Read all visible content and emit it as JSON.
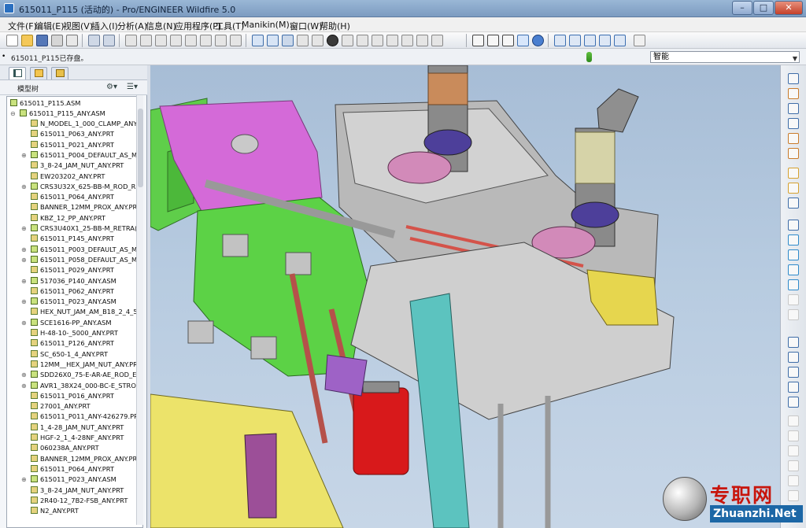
{
  "window": {
    "title": "615011_P115 (活动的) - Pro/ENGINEER Wildfire 5.0",
    "controls": {
      "minimize": "–",
      "maximize": "□",
      "close": "✕"
    }
  },
  "menu": {
    "items": [
      "文件(F)",
      "编辑(E)",
      "视图(V)",
      "插入(I)",
      "分析(A)",
      "信息(N)",
      "应用程序(P)",
      "工具(T)",
      "Manikin(M)...",
      "窗口(W)",
      "帮助(H)"
    ]
  },
  "toolbar": {
    "icons": [
      "new-icon",
      "open-icon",
      "save-icon",
      "print-icon",
      "send-icon",
      "undo-icon",
      "redo-icon",
      "cut-icon",
      "copy-icon",
      "paste-icon",
      "paste-special-icon",
      "find-icon",
      "select-icon",
      "rename-icon",
      "regenerate-icon",
      "datum-display-icon",
      "orient-icon",
      "appearance-icon",
      "pan-icon",
      "zoom-in-icon",
      "zoom-out-icon",
      "refit-icon",
      "reorient-icon",
      "saved-views-icon",
      "layers-icon",
      "wireframe-icon",
      "hidden-line-icon",
      "no-hidden-icon",
      "shading-icon",
      "enhanced-realism-icon",
      "plane-display-icon",
      "axis-display-icon",
      "point-display-icon",
      "csys-display-icon",
      "spin-center-icon",
      "context-help-icon"
    ]
  },
  "message": {
    "bullet": "•",
    "text": "615011_P115已存盘。"
  },
  "filter": {
    "value": "智能"
  },
  "panel": {
    "tabs": [
      "model-tree-tab",
      "folder-tab",
      "favorites-tab"
    ],
    "header_label": "模型树",
    "settings_icon": "tree-settings-icon",
    "show_icon": "tree-show-icon"
  },
  "tree": {
    "root": "615011_P115.ASM",
    "sub_root": "615011_P115_ANY.ASM",
    "items": [
      {
        "label": "N_MODEL_1_000_CLAMP_ANY",
        "type": "prt",
        "exp": ""
      },
      {
        "label": "615011_P063_ANY.PRT",
        "type": "prt",
        "exp": ""
      },
      {
        "label": "615011_P021_ANY.PRT",
        "type": "prt",
        "exp": ""
      },
      {
        "label": "615011_P004_DEFAULT_AS_M/",
        "type": "asm",
        "exp": "⊕"
      },
      {
        "label": "3_8-24_JAM_NUT_ANY.PRT",
        "type": "prt",
        "exp": ""
      },
      {
        "label": "EW203202_ANY.PRT",
        "type": "prt",
        "exp": ""
      },
      {
        "label": "CRS3U32X_625-BB-M_ROD_R",
        "type": "asm",
        "exp": "⊕"
      },
      {
        "label": "615011_P064_ANY.PRT",
        "type": "prt",
        "exp": ""
      },
      {
        "label": "BANNER_12MM_PROX_ANY.PR",
        "type": "prt",
        "exp": ""
      },
      {
        "label": "KBZ_12_PP_ANY.PRT",
        "type": "prt",
        "exp": ""
      },
      {
        "label": "CRS3U40X1_25-BB-M_RETRA(",
        "type": "asm",
        "exp": "⊕"
      },
      {
        "label": "615011_P145_ANY.PRT",
        "type": "prt",
        "exp": ""
      },
      {
        "label": "615011_P003_DEFAULT_AS_M/",
        "type": "asm",
        "exp": "⊕"
      },
      {
        "label": "615011_P058_DEFAULT_AS_M/",
        "type": "asm",
        "exp": "⊕"
      },
      {
        "label": "615011_P029_ANY.PRT",
        "type": "prt",
        "exp": ""
      },
      {
        "label": "517036_P140_ANY.ASM",
        "type": "asm",
        "exp": "⊕"
      },
      {
        "label": "615011_P062_ANY.PRT",
        "type": "prt",
        "exp": ""
      },
      {
        "label": "615011_P023_ANY.ASM",
        "type": "asm",
        "exp": "⊕"
      },
      {
        "label": "HEX_NUT_JAM_AM_B18_2_4_5",
        "type": "prt",
        "exp": ""
      },
      {
        "label": "SCE1616-PP_ANY.ASM",
        "type": "asm",
        "exp": "⊕"
      },
      {
        "label": "H-48-10-_5000_ANY.PRT",
        "type": "prt",
        "exp": ""
      },
      {
        "label": "615011_P126_ANY.PRT",
        "type": "prt",
        "exp": ""
      },
      {
        "label": "SC_650-1_4_ANY.PRT",
        "type": "prt",
        "exp": ""
      },
      {
        "label": "12MM__HEX_JAM_NUT_ANY.PR",
        "type": "prt",
        "exp": ""
      },
      {
        "label": "SDD26X0_75-E-AR-AE_ROD_E",
        "type": "asm",
        "exp": "⊕"
      },
      {
        "label": "AVR1_38X24_000-BC-E_STROI",
        "type": "asm",
        "exp": "⊕"
      },
      {
        "label": "615011_P016_ANY.PRT",
        "type": "prt",
        "exp": ""
      },
      {
        "label": "27001_ANY.PRT",
        "type": "prt",
        "exp": ""
      },
      {
        "label": "615011_P011_ANY-426279.PRT",
        "type": "prt",
        "exp": ""
      },
      {
        "label": "1_4-28_JAM_NUT_ANY.PRT",
        "type": "prt",
        "exp": ""
      },
      {
        "label": "HGF-2_1_4-28NF_ANY.PRT",
        "type": "prt",
        "exp": ""
      },
      {
        "label": "060238A_ANY.PRT",
        "type": "prt",
        "exp": ""
      },
      {
        "label": "BANNER_12MM_PROX_ANY.PRT",
        "type": "prt",
        "exp": ""
      },
      {
        "label": "615011_P064_ANY.PRT",
        "type": "prt",
        "exp": ""
      },
      {
        "label": "615011_P023_ANY.ASM",
        "type": "asm",
        "exp": "⊕"
      },
      {
        "label": "3_8-24_JAM_NUT_ANY.PRT",
        "type": "prt",
        "exp": ""
      },
      {
        "label": "2R40-12_7B2-FSB_ANY.PRT",
        "type": "prt",
        "exp": ""
      },
      {
        "label": "N2_ANY.PRT",
        "type": "prt",
        "exp": ""
      }
    ]
  },
  "right_toolbar": {
    "icons": [
      "sketch-icon",
      "plane-icon",
      "axis-icon",
      "curve-icon",
      "point-icon",
      "csys-icon",
      "extrude-icon",
      "revolve-icon",
      "variable-sweep-icon",
      "blend-icon",
      "hole-icon",
      "shell-icon",
      "rib-icon",
      "draft-icon",
      "round-icon",
      "chamfer-icon",
      "copy-feature-icon",
      "mirror-icon",
      "merge-icon",
      "trim-icon",
      "pattern-icon",
      "offset-icon",
      "thicken-icon",
      "solidify-icon",
      "intersect-icon",
      "project-icon",
      "wrap-icon"
    ]
  },
  "watermark": {
    "chinese": "专职网",
    "url": "Zhuanzhi.Net"
  },
  "colors": {
    "accent": "#2a6fbf",
    "viewport_top": "#a7bdd6",
    "viewport_bottom": "#c7d6e7",
    "magenta_plate": "#d46ad8",
    "green_frame": "#5fce4a",
    "motor_red": "#d8191b",
    "yellow_base": "#ece36a",
    "plate_gray": "#c9c9c9"
  }
}
